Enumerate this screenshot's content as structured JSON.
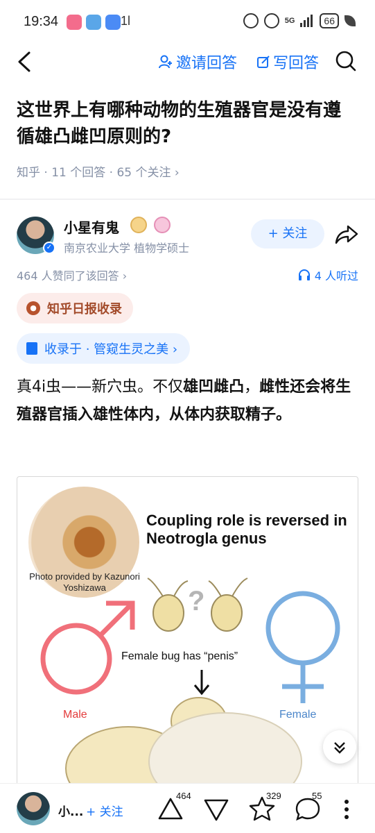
{
  "status_bar": {
    "time": "19:34",
    "extra": "1l",
    "network": "5G",
    "battery": "66"
  },
  "nav": {
    "invite_label": "邀请回答",
    "write_label": "写回答"
  },
  "question": {
    "title": "这世界上有哪种动物的生殖器官是没有遵循雄凸雌凹原则的?",
    "meta": "知乎 · 11 个回答 · 65 个关注 ›"
  },
  "author": {
    "name": "小星有鬼",
    "bio": "南京农业大学 植物学硕士",
    "follow_label": "+ 关注"
  },
  "stats": {
    "upvotes": "464 人赞同了该回答 ›",
    "listeners": "4 人听过"
  },
  "tags": {
    "daily": "知乎日报收录",
    "collection": "收录于 · 管窥生灵之美 ›"
  },
  "answer": {
    "part1": "真4i虫——新穴虫。不仅",
    "bold1": "雄凹雌凸",
    "part2": "，",
    "bold2": "雌性还会将生殖器官插入雄性体内，从体内获取精子。"
  },
  "figure": {
    "photo_caption": "Photo provided by Kazunori Yoshizawa",
    "title": "Coupling role is reversed in Neotrogla genus",
    "note": "Female bug has “penis”",
    "male_label": "Male",
    "female_label": "Female",
    "male_color": "#f0707a",
    "female_color": "#7aaee0"
  },
  "bottom_bar": {
    "name": "小...",
    "follow_label": "+ 关注",
    "upvote_count": "464",
    "favorite_count": "329",
    "comment_count": "55"
  },
  "colors": {
    "accent": "#1772f6",
    "muted": "#8590a6",
    "daily_tag": "#a34b2b"
  },
  "icons": [
    "back-icon",
    "invite-icon",
    "write-icon",
    "search-icon",
    "share-icon",
    "headphones-icon",
    "daily-icon",
    "bookmark-icon",
    "expand-icon",
    "upvote-icon",
    "downvote-icon",
    "star-icon",
    "comment-icon",
    "more-icon"
  ]
}
